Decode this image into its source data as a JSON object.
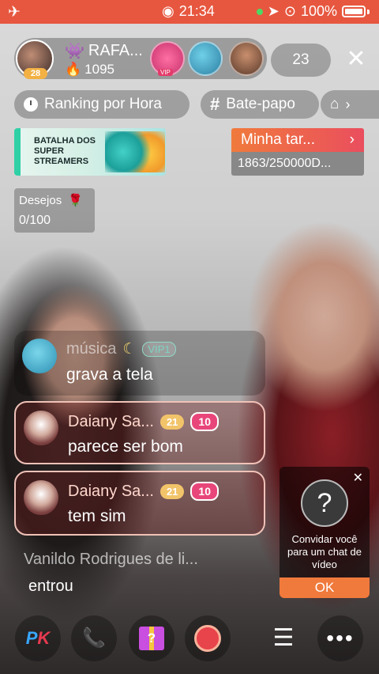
{
  "status_bar": {
    "time": "21:34",
    "battery": "100%",
    "airplane_icon": "airplane-icon"
  },
  "host": {
    "name": "RAFA...",
    "level": "28",
    "fire_count": "1095"
  },
  "viewers": {
    "vip_label": "VIP",
    "count": "23"
  },
  "pills": {
    "ranking": "Ranking por Hora",
    "chat": "Bate-papo"
  },
  "banners": {
    "battle_text": "BATALHA DOS SUPER STREAMERS",
    "mission_title": "Minha tar...",
    "mission_progress": "1863/250000D..."
  },
  "wishes": {
    "title": "Desejos",
    "value": "0/100"
  },
  "chat": [
    {
      "name": "música",
      "badge": "VIP1",
      "text": "grava a tela"
    },
    {
      "name": "Daiany Sa...",
      "level": "21",
      "hearts": "10",
      "text": "parece ser bom"
    },
    {
      "name": "Daiany Sa...",
      "level": "21",
      "hearts": "10",
      "text": "tem sim"
    }
  ],
  "join": {
    "name": "Vanildo Rodrigues de li...",
    "text": "entrou"
  },
  "invite": {
    "text": "Convidar você para um chat de vídeo",
    "ok": "OK"
  },
  "bottom_bar": {
    "pk_p": "P",
    "pk_k": "K",
    "gift_mark": "?"
  }
}
